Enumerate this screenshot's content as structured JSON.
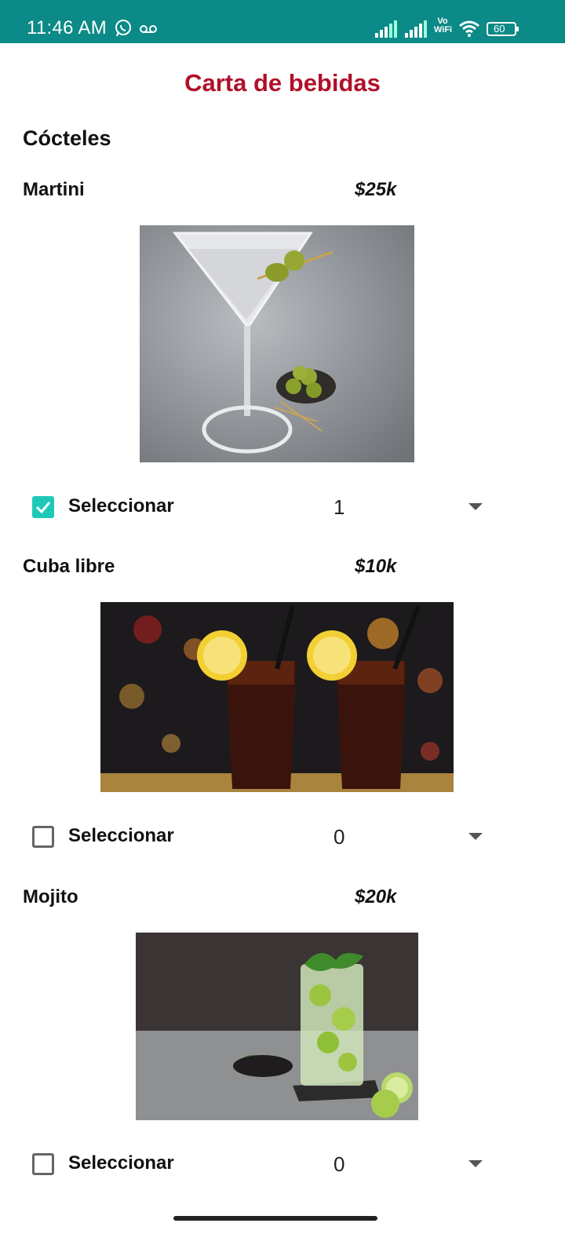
{
  "status_bar": {
    "time": "11:46 AM",
    "vowifi_top": "Vo",
    "vowifi_bottom": "WiFi",
    "battery": "60",
    "icons": [
      "whatsapp-icon",
      "voicemail-icon",
      "signal-icon",
      "signal-icon",
      "vowifi-icon",
      "wifi-icon",
      "battery-icon"
    ]
  },
  "page": {
    "title": "Carta de bebidas",
    "section_title": "Cócteles"
  },
  "items": [
    {
      "name": "Martini",
      "price": "$25k",
      "select_label": "Seleccionar",
      "selected": true,
      "quantity": "1"
    },
    {
      "name": "Cuba libre",
      "price": "$10k",
      "select_label": "Seleccionar",
      "selected": false,
      "quantity": "0"
    },
    {
      "name": "Mojito",
      "price": "$20k",
      "select_label": "Seleccionar",
      "selected": false,
      "quantity": "0"
    }
  ],
  "colors": {
    "status_bar": "#0b8a87",
    "title": "#b0102a",
    "checkbox_checked": "#1fc9b8"
  }
}
